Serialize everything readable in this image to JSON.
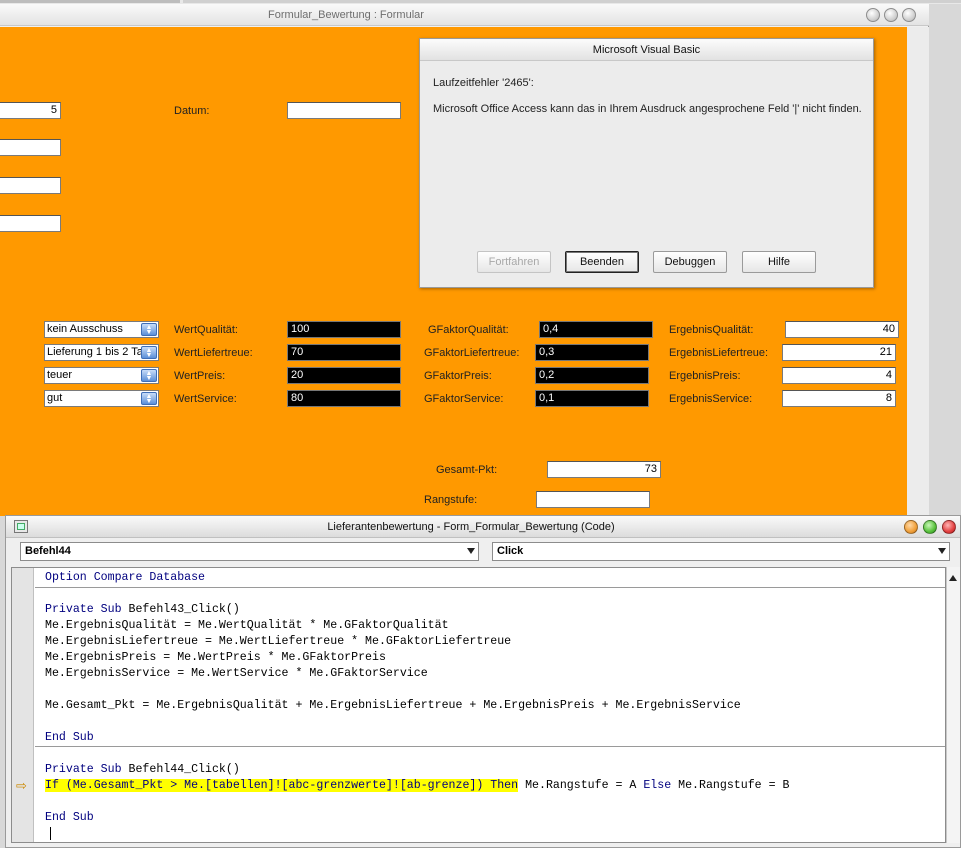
{
  "form": {
    "title": "Formular_Bewertung : Formular",
    "left_fields": [
      "5",
      "",
      "",
      ""
    ],
    "datum_label": "Datum:",
    "datum_value": "",
    "gesamt_label": "Gesamt-Pkt:",
    "gesamt_value": "73",
    "rang_label": "Rangstufe:",
    "rang_value": "",
    "rows": [
      {
        "combo": "kein Ausschuss",
        "wert_label": "WertQualität:",
        "wert": "100",
        "gfaktor_label": "GFaktorQualität:",
        "gfaktor": "0,4",
        "ergebnis_label": "ErgebnisQualität:",
        "ergebnis": "40"
      },
      {
        "combo": "Lieferung 1 bis 2 Ta",
        "wert_label": "WertLiefertreue:",
        "wert": "70",
        "gfaktor_label": "GFaktorLiefertreue:",
        "gfaktor": "0,3",
        "ergebnis_label": "ErgebnisLiefertreue:",
        "ergebnis": "21"
      },
      {
        "combo": "teuer",
        "wert_label": "WertPreis:",
        "wert": "20",
        "gfaktor_label": "GFaktorPreis:",
        "gfaktor": "0,2",
        "ergebnis_label": "ErgebnisPreis:",
        "ergebnis": "4"
      },
      {
        "combo": "gut",
        "wert_label": "WertService:",
        "wert": "80",
        "gfaktor_label": "GFaktorService:",
        "gfaktor": "0,1",
        "ergebnis_label": "ErgebnisService:",
        "ergebnis": "8"
      }
    ]
  },
  "msgbox": {
    "title": "Microsoft Visual Basic",
    "error": "Laufzeitfehler '2465':",
    "message": "Microsoft Office Access kann das in Ihrem Ausdruck angesprochene Feld '|' nicht finden.",
    "buttons": {
      "continue": "Fortfahren",
      "end": "Beenden",
      "debug": "Debuggen",
      "help": "Hilfe"
    }
  },
  "code": {
    "title": "Lieferantenbewertung - Form_Formular_Bewertung (Code)",
    "object_dropdown": "Befehl44",
    "procedure_dropdown": "Click",
    "lines": {
      "l0_kw": "Option Compare Database",
      "l2_kw": "Private Sub",
      "l2_rest": " Befehl43_Click()",
      "l3": "Me.ErgebnisQualität = Me.WertQualität * Me.GFaktorQualität",
      "l4": "Me.ErgebnisLiefertreue = Me.WertLiefertreue * Me.GFaktorLiefertreue",
      "l5": "Me.ErgebnisPreis = Me.WertPreis * Me.GFaktorPreis",
      "l6": "Me.ErgebnisService = Me.WertService * Me.GFaktorService",
      "l8": "Me.Gesamt_Pkt = Me.ErgebnisQualität + Me.ErgebnisLiefertreue + Me.ErgebnisPreis + Me.ErgebnisService",
      "l10_kw": "End Sub",
      "l12_kw": "Private Sub",
      "l12_rest": " Befehl44_Click()",
      "l13_hl": "If (Me.Gesamt_Pkt > Me.[tabellen]![abc-grenzwerte]![ab-grenze]) Then",
      "l13_rest": " Me.Rangstufe = A ",
      "l13_else": "Else",
      "l13_end": " Me.Rangstufe = B",
      "l15_kw": "End Sub"
    }
  }
}
